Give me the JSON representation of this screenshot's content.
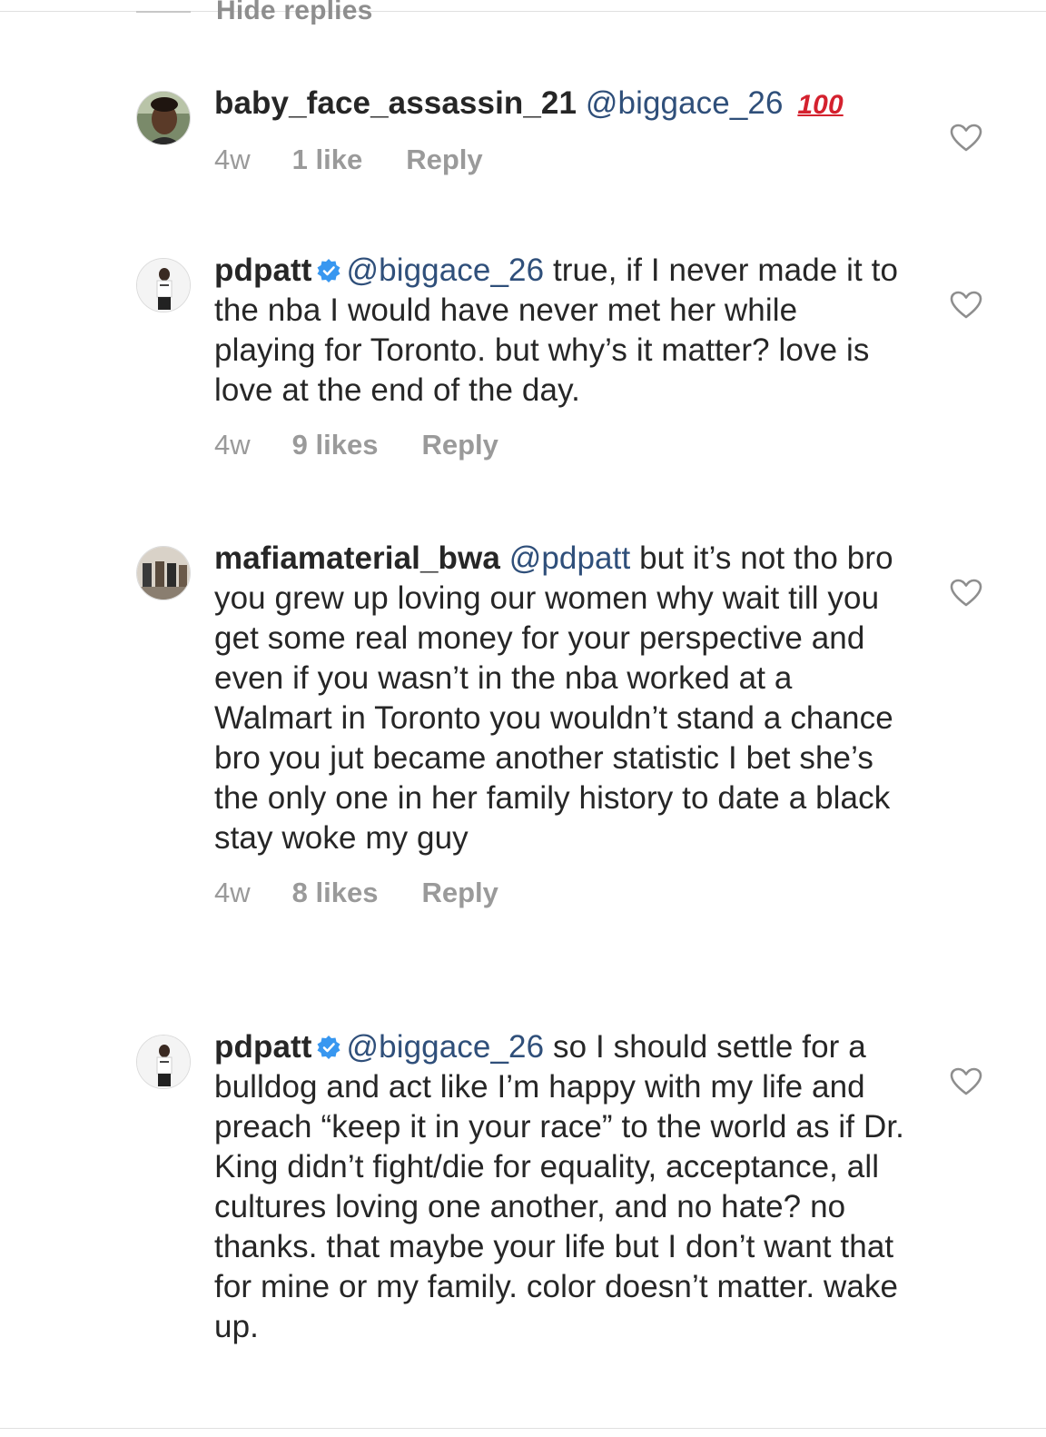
{
  "thread": {
    "hide_replies_label": "Hide replies"
  },
  "comments": [
    {
      "username": "baby_face_assassin_21",
      "verified": false,
      "mention": "@biggace_26",
      "text": "",
      "emoji": "💯",
      "emoji_text": "100",
      "time": "4w",
      "likes": "1 like",
      "reply_label": "Reply"
    },
    {
      "username": "pdpatt",
      "verified": true,
      "mention": "@biggace_26",
      "text": " true, if I never made it to the nba I would have never met her while playing for Toronto. but why’s it matter? love is love at the end of the day.",
      "time": "4w",
      "likes": "9 likes",
      "reply_label": "Reply"
    },
    {
      "username": "mafiamaterial_bwa",
      "verified": false,
      "mention": "@pdpatt",
      "text": " but it’s not tho bro you grew up loving our women why wait till you get some real money for your perspective and even if you wasn’t in the nba worked at a Walmart in Toronto you wouldn’t stand a chance bro you jut became another statistic I bet she’s the only one in her family history to date a black stay woke my guy",
      "time": "4w",
      "likes": "8 likes",
      "reply_label": "Reply"
    },
    {
      "username": "pdpatt",
      "verified": true,
      "mention": "@biggace_26",
      "text": " so I should settle for a bulldog and act like I’m happy with my life and preach “keep it in your race” to the world as if Dr. King didn’t fight/die for equality, acceptance, all cultures loving one another, and no hate? no thanks. that maybe your life but I don’t want that for mine or my family. color doesn’t matter. wake up."
    }
  ],
  "colors": {
    "text": "#262626",
    "mention": "#2f4f7a",
    "meta": "#9a9a9a",
    "verified": "#3897f0",
    "emoji": "#d4212e"
  },
  "icons": {
    "like": "heart-outline-icon",
    "verified": "verified-badge-icon"
  }
}
